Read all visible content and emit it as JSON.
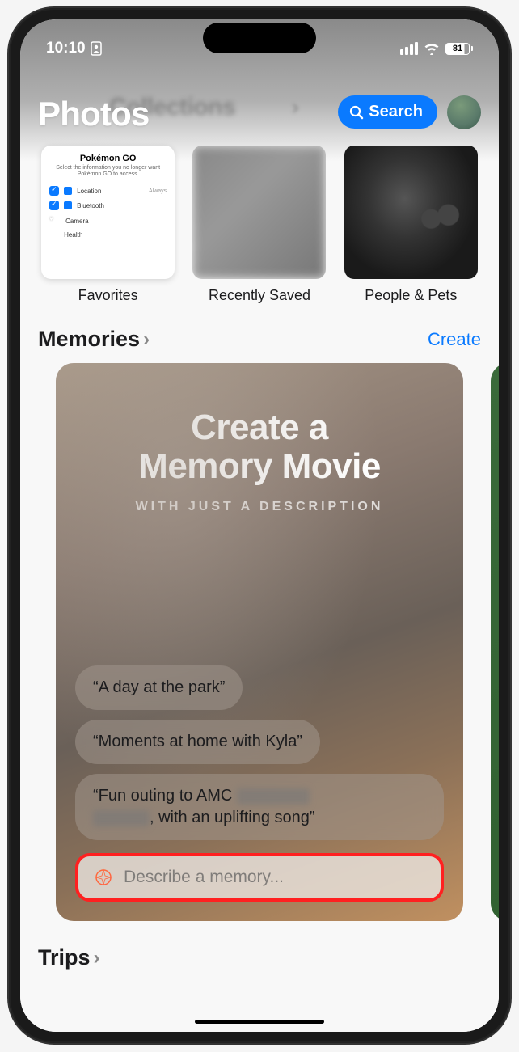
{
  "status": {
    "time": "10:10",
    "battery": "81"
  },
  "header": {
    "app_title": "Photos",
    "blurred_background_title": "Collections",
    "search_label": "Search"
  },
  "collections": [
    {
      "label": "Favorites",
      "mock": {
        "title": "Pokémon GO",
        "sub": "Select the information you no longer want Pokémon GO to access.",
        "rows": [
          "Location",
          "Bluetooth",
          "Camera",
          "Health"
        ],
        "always": "Always"
      }
    },
    {
      "label": "Recently Saved"
    },
    {
      "label": "People & Pets"
    }
  ],
  "memories": {
    "section_title": "Memories",
    "create_label": "Create",
    "card_title_line1": "Create a",
    "card_title_line2": "Memory Movie",
    "card_subtitle": "WITH JUST A DESCRIPTION",
    "suggestions": [
      "“A day at the park”",
      "“Moments at home with Kyla”"
    ],
    "suggestion_redacted_prefix": "“Fun outing to AMC ",
    "suggestion_redacted_suffix": ", with an uplifting song”",
    "input_placeholder": "Describe a memory..."
  },
  "trips": {
    "section_title": "Trips"
  }
}
